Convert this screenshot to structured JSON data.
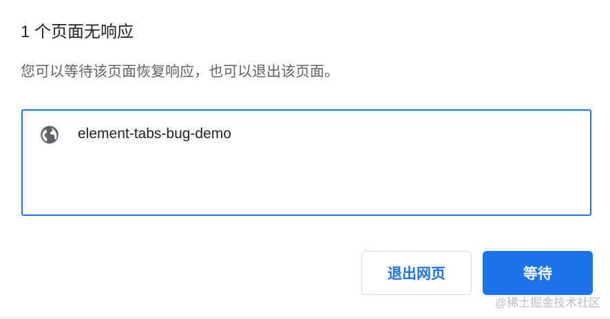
{
  "dialog": {
    "title": "1 个页面无响应",
    "message": "您可以等待该页面恢复响应，也可以退出该页面。"
  },
  "page_list": {
    "items": [
      {
        "icon": "globe-icon",
        "name": "element-tabs-bug-demo"
      }
    ]
  },
  "buttons": {
    "exit_label": "退出网页",
    "wait_label": "等待"
  },
  "watermark": {
    "text": "@稀土掘金技术社区"
  },
  "colors": {
    "accent": "#1a73e8",
    "title_text": "#202124",
    "secondary_text": "#5f6368",
    "button_border": "#dadce0"
  }
}
